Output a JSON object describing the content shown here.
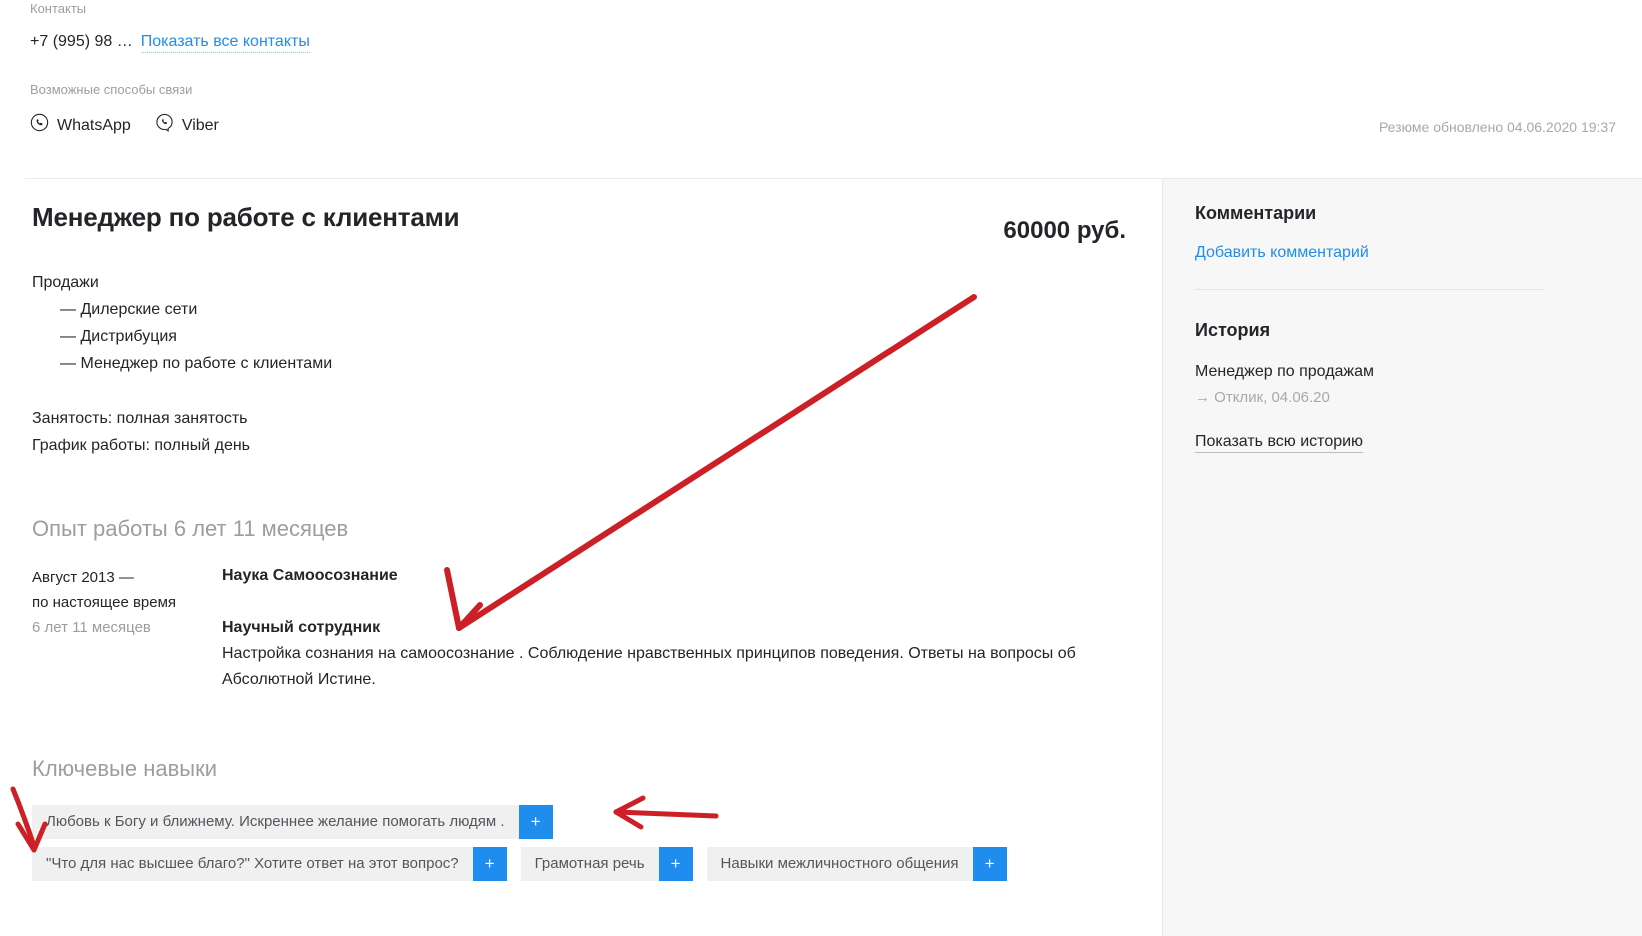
{
  "contacts": {
    "label": "Контакты",
    "phone": "+7 (995) 98 …",
    "show_all_link": "Показать все контакты",
    "ways_label": "Возможные способы связи",
    "messengers": [
      {
        "name": "WhatsApp",
        "icon": "whatsapp-icon"
      },
      {
        "name": "Viber",
        "icon": "viber-icon"
      }
    ]
  },
  "updated": "Резюме обновлено 04.06.2020 19:37",
  "resume": {
    "title": "Менеджер по работе с клиентами",
    "salary": "60000 руб.",
    "desc_head": "Продажи",
    "desc_bullets": [
      "— Дилерские сети",
      "— Дистрибуция",
      "— Менеджер по работе с клиентами"
    ],
    "employment": "Занятость: полная занятость",
    "schedule": "График работы: полный день"
  },
  "experience": {
    "section_title": "Опыт работы 6 лет 11 месяцев",
    "items": [
      {
        "period_from": "Август 2013 —",
        "period_to": "по настоящее время",
        "duration": "6 лет 11 месяцев",
        "company": "Наука Самоосознание",
        "position": "Научный сотрудник",
        "text": "Настройка сознания на самоосознание . Соблюдение нравственных принципов поведения. Ответы на вопросы об Абсолютной Истине."
      }
    ]
  },
  "skills": {
    "section_title": "Ключевые навыки",
    "add_label": "+",
    "rows": [
      [
        "Любовь к Богу и ближнему. Искреннее желание помогать людям ."
      ],
      [
        "\"Что для нас высшее благо?\" Хотите ответ на этот вопрос?",
        "Грамотная речь",
        "Навыки межличностного общения"
      ]
    ]
  },
  "sidebar": {
    "comments_title": "Комментарии",
    "add_comment_link": "Добавить комментарий",
    "history_title": "История",
    "history_item": "Менеджер по продажам",
    "history_sub": "→ Отклик, 04.06.20",
    "show_all_history": "Показать всю историю"
  },
  "colors": {
    "link": "#1f8ded",
    "accent_blue": "#1f8ded",
    "annotation_red": "#cc2026",
    "muted": "#9a9da1",
    "sidebar_bg": "#f7f7f8",
    "tag_bg": "#f0f0f1"
  }
}
